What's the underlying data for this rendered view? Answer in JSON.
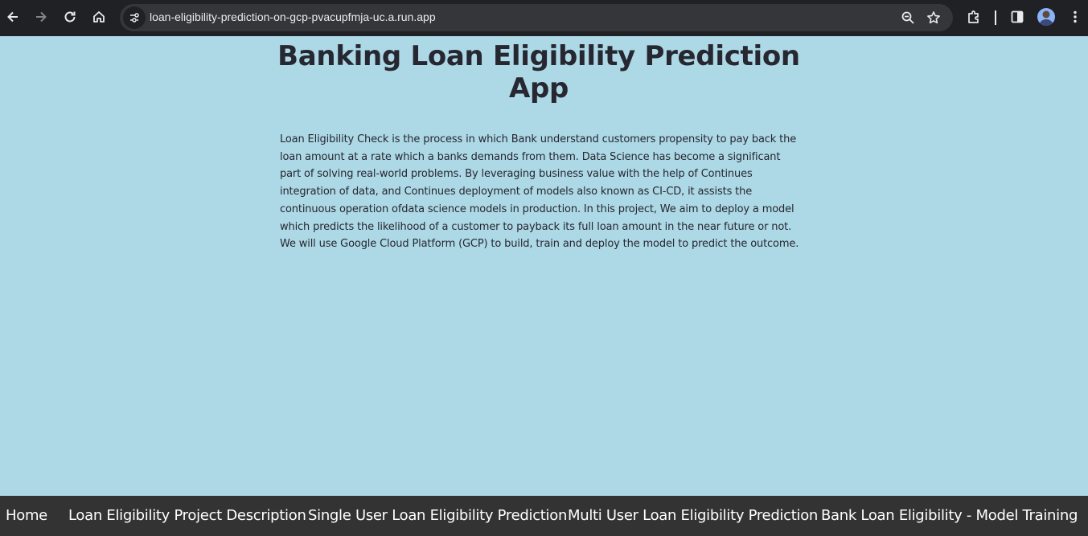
{
  "browser": {
    "url": "loan-eligibility-prediction-on-gcp-pvacupfmja-uc.a.run.app",
    "icons": [
      "back-icon",
      "forward-icon",
      "reload-icon",
      "home-icon",
      "site-info-icon",
      "zoom-icon",
      "bookmark-star-icon",
      "extensions-icon",
      "side-panel-icon",
      "profile-avatar",
      "menu-kebab-icon"
    ]
  },
  "page": {
    "title": "Banking Loan Eligibility Prediction App",
    "description": "Loan Eligibility Check is the process in which Bank understand customers propensity to pay back the loan amount at a rate which a banks demands from them. Data Science has become a significant part of solving real-world problems. By leveraging business value with the help of Continues integration of data, and Continues deployment of models also known as CI-CD, it assists the continuous operation ofdata science models in production. In this project, We aim to deploy a model which predicts the likelihood of a customer to payback its full loan amount in the near future or not. We will use Google Cloud Platform (GCP) to build, train and deploy the model to predict the outcome.",
    "background_color": "#add8e6",
    "text_color": "#262730"
  },
  "navbar": {
    "background_color": "#333333",
    "items": [
      {
        "label": "Home"
      },
      {
        "label": "Loan Eligibility Project Description"
      },
      {
        "label": "Single User Loan Eligibility Prediction"
      },
      {
        "label": "Multi User Loan Eligibility Prediction"
      },
      {
        "label": "Bank Loan Eligibility - Model Training"
      }
    ]
  }
}
